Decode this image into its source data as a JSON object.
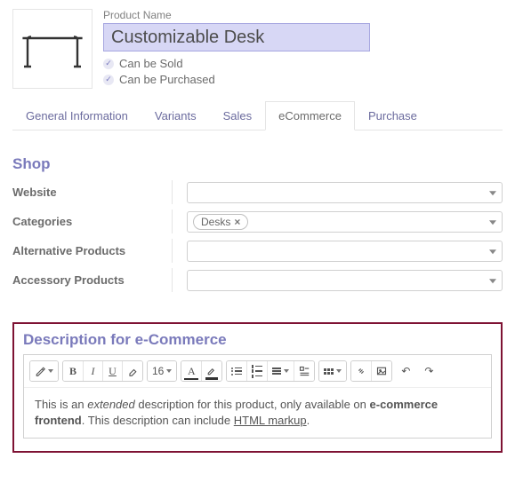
{
  "header": {
    "name_label": "Product Name",
    "name_value": "Customizable Desk",
    "can_be_sold": "Can be Sold",
    "can_be_purchased": "Can be Purchased"
  },
  "tabs": {
    "general": "General Information",
    "variants": "Variants",
    "sales": "Sales",
    "ecommerce": "eCommerce",
    "purchase": "Purchase"
  },
  "shop": {
    "title": "Shop",
    "website_label": "Website",
    "categories_label": "Categories",
    "category_tag": "Desks",
    "alt_products_label": "Alternative Products",
    "acc_products_label": "Accessory Products"
  },
  "desc": {
    "title": "Description for e-Commerce",
    "fontsize": "16",
    "content_prefix": "This is an ",
    "content_em": "extended",
    "content_mid": " description for this product, only available on ",
    "content_bold": "e-commerce frontend",
    "content_after_bold": ". This description can include ",
    "content_u": "HTML markup",
    "content_end": "."
  }
}
